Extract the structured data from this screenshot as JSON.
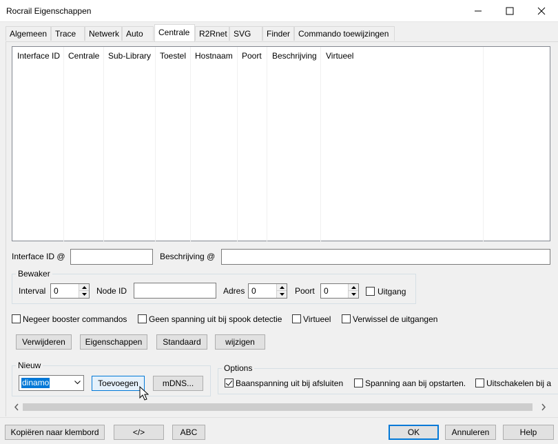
{
  "window": {
    "title": "Rocrail Eigenschappen"
  },
  "tabs": [
    "Algemeen",
    "Trace",
    "Netwerk",
    "Auto",
    "Centrale",
    "R2Rnet",
    "SVG",
    "Finder",
    "Commando toewijzingen"
  ],
  "active_tab": "Centrale",
  "list": {
    "columns": [
      "Interface ID",
      "Centrale",
      "Sub-Library",
      "Toestel",
      "Hostnaam",
      "Poort",
      "Beschrijving",
      "Virtueel"
    ]
  },
  "fields": {
    "interface_id_label": "Interface ID @",
    "interface_id_value": "",
    "beschrijving_label": "Beschrijving @",
    "beschrijving_value": ""
  },
  "bewaker": {
    "title": "Bewaker",
    "interval_label": "Interval",
    "interval_value": "0",
    "node_id_label": "Node ID",
    "node_id_value": "",
    "adres_label": "Adres",
    "adres_value": "0",
    "poort_label": "Poort",
    "poort_value": "0",
    "uitgang_label": "Uitgang",
    "uitgang_checked": false
  },
  "options_row": {
    "negeer_booster": "Negeer booster commandos",
    "geen_spanning": "Geen spanning uit bij spook detectie",
    "virtueel": "Virtueel",
    "verwissel": "Verwissel de uitgangen"
  },
  "actions": {
    "verwijderen": "Verwijderen",
    "eigenschappen": "Eigenschappen",
    "standaard": "Standaard",
    "wijzigen": "wijzigen"
  },
  "nieuw": {
    "title": "Nieuw",
    "selected": "dinamo",
    "toevoegen": "Toevoegen",
    "mdns": "mDNS..."
  },
  "options": {
    "title": "Options",
    "baanspanning": "Baanspanning uit bij afsluiten",
    "baanspanning_checked": true,
    "spanning_aan": "Spanning aan bij opstarten.",
    "spanning_aan_checked": false,
    "uitschakelen": "Uitschakelen bij a",
    "uitschakelen_checked": false
  },
  "footer": {
    "kopieren": "Kopiëren naar klembord",
    "code": "</>",
    "abc": "ABC",
    "ok": "OK",
    "annuleren": "Annuleren",
    "help": "Help"
  },
  "colors": {
    "accent": "#0078d7",
    "window_bg": "#f0f0f0"
  }
}
